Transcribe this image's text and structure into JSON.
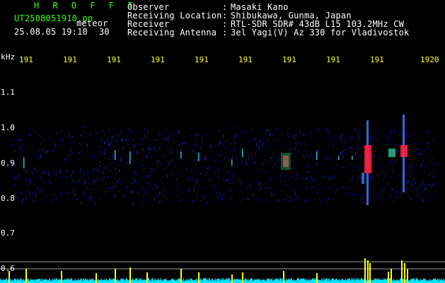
{
  "header": {
    "title": "H R O F F T",
    "filename": "UT2508051910.pn",
    "meteor_label": "meteor",
    "datetime": "25.08.05 19:10",
    "duration": "30",
    "info": [
      {
        "label": "Observer",
        "value": "Masaki Kano"
      },
      {
        "label": "Receiving Location",
        "value": "Shibukawa, Gunma, Japan"
      },
      {
        "label": "Receiver",
        "value": "RTL-SDR SDR# 43dB L15 103.2MHz CW"
      },
      {
        "label": "Receiving Antenna",
        "value": "3el Yagi(V) Az 330 for Vladivostok"
      }
    ]
  },
  "axis": {
    "unit_label": "kHz",
    "x_ticks": [
      "191",
      "191",
      "191",
      "191",
      "191",
      "191",
      "191",
      "191",
      "191",
      "1920"
    ],
    "y_ticks": [
      "1.1",
      "1.0",
      "0.9",
      "0.8",
      "0.7",
      "0.6"
    ]
  },
  "colors": {
    "text_green": "#39ff14",
    "text_white": "#ffffff",
    "text_yellow": "#ffff33",
    "noise_blue": "#1a2aff",
    "echo_red": "#ff2040",
    "meter_yellow": "#ffff00",
    "meter_cyan": "#00e5ff"
  }
}
